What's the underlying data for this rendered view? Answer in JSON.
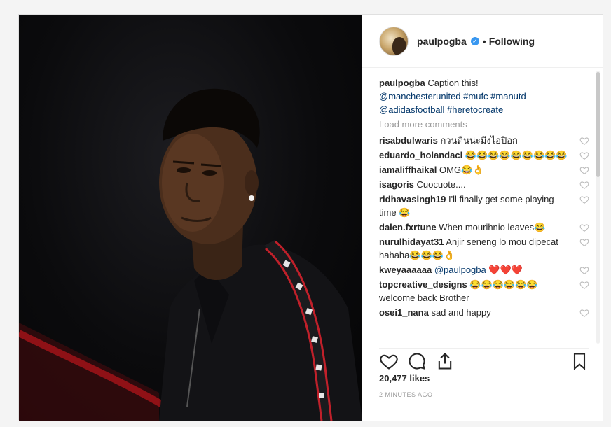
{
  "post": {
    "username": "paulpogba",
    "follow_state": "Following",
    "caption_user": "paulpogba",
    "caption_text": "Caption this!",
    "caption_tags_line1": "@manchesterunited #mufc #manutd",
    "caption_tags_line2": "@adidasfootball #heretocreate",
    "load_more": "Load more comments",
    "likes": "20,477 likes",
    "time": "2 MINUTES AGO"
  },
  "comments": [
    {
      "user": "risabdulwaris",
      "text": "กวนตีนน่ะมึงไอปิอก"
    },
    {
      "user": "eduardo_holandacl",
      "text": "😂😂😂😂😂😂😂😂😂"
    },
    {
      "user": "iamaliffhaikal",
      "text": "OMG😂👌"
    },
    {
      "user": "isagoris",
      "text": "Cuocuote...."
    },
    {
      "user": "ridhavasingh19",
      "text": "I'll finally get some playing time 😂"
    },
    {
      "user": "dalen.fxrtune",
      "text": "When mourihnio leaves😂"
    },
    {
      "user": "nurulhidayat31",
      "text": "Anjir seneng lo mou dipecat hahaha😂😂😂👌"
    },
    {
      "user": "kweyaaaaaa",
      "text": "@paulpogba ❤️❤️❤️"
    },
    {
      "user": "topcreative_designs",
      "text": "😂😂😂😂😂😂 welcome back Brother"
    },
    {
      "user": "osei1_nana",
      "text": "sad and happy"
    }
  ],
  "icons": {
    "verified": "verified-badge-icon",
    "like": "heart-icon",
    "comment": "comment-bubble-icon",
    "share": "share-icon",
    "save": "bookmark-icon"
  },
  "colors": {
    "link": "#003569",
    "verified": "#3897f0",
    "muted": "#999999"
  }
}
